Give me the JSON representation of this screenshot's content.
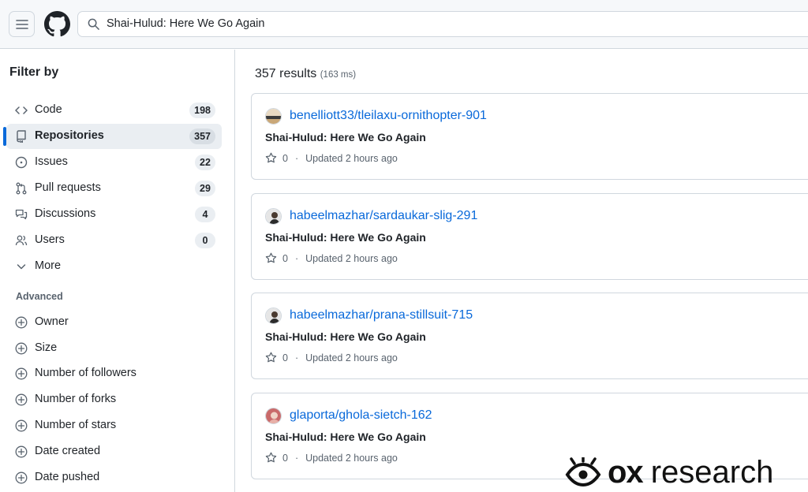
{
  "header": {
    "search_text": "Shai-Hulud: Here We Go Again"
  },
  "sidebar": {
    "title": "Filter by",
    "items": [
      {
        "label": "Code",
        "count": "198",
        "icon": "code-icon"
      },
      {
        "label": "Repositories",
        "count": "357",
        "icon": "repo-icon",
        "active": true
      },
      {
        "label": "Issues",
        "count": "22",
        "icon": "issue-icon"
      },
      {
        "label": "Pull requests",
        "count": "29",
        "icon": "pull-request-icon"
      },
      {
        "label": "Discussions",
        "count": "4",
        "icon": "discussion-icon"
      },
      {
        "label": "Users",
        "count": "0",
        "icon": "people-icon"
      },
      {
        "label": "More",
        "icon": "chevron-down-icon"
      }
    ],
    "advanced_title": "Advanced",
    "advanced_items": [
      {
        "label": "Owner"
      },
      {
        "label": "Size"
      },
      {
        "label": "Number of followers"
      },
      {
        "label": "Number of forks"
      },
      {
        "label": "Number of stars"
      },
      {
        "label": "Date created"
      },
      {
        "label": "Date pushed"
      }
    ]
  },
  "results": {
    "count": "357 results",
    "timing": "(163 ms)",
    "items": [
      {
        "repo": "benelliott33/tleilaxu-ornithopter-901",
        "description": "Shai-Hulud: Here We Go Again",
        "stars": "0",
        "updated": "Updated 2 hours ago"
      },
      {
        "repo": "habeelmazhar/sardaukar-slig-291",
        "description": "Shai-Hulud: Here We Go Again",
        "stars": "0",
        "updated": "Updated 2 hours ago"
      },
      {
        "repo": "habeelmazhar/prana-stillsuit-715",
        "description": "Shai-Hulud: Here We Go Again",
        "stars": "0",
        "updated": "Updated 2 hours ago"
      },
      {
        "repo": "glaporta/ghola-sietch-162",
        "description": "Shai-Hulud: Here We Go Again",
        "stars": "0",
        "updated": "Updated 2 hours ago"
      }
    ]
  },
  "watermark": {
    "brand": "ox",
    "text": "research"
  },
  "colors": {
    "link": "#0969da",
    "active_bar": "#0969da",
    "muted": "#59636e"
  }
}
